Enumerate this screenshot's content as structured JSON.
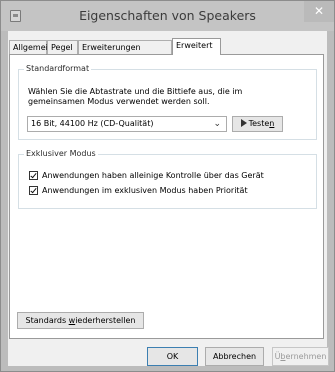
{
  "window": {
    "title": "Eigenschaften von Speakers",
    "close_glyph": "✕",
    "app_icon": "speaker-properties-icon"
  },
  "tabs": [
    {
      "label": "Allgemein"
    },
    {
      "label": "Pegel"
    },
    {
      "label": "Erweiterungen"
    },
    {
      "label": "Erweitert",
      "active": true
    }
  ],
  "standard_format": {
    "group_label": "Standardformat",
    "description": "Wählen Sie die Abtastrate und die Bittiefe aus, die im gemeinsamen Modus verwendet werden soll.",
    "selected_format": "16 Bit, 44100 Hz (CD-Qualität)",
    "test_label_pre": "Teste",
    "test_label_accel": "n"
  },
  "exclusive_mode": {
    "group_label": "Exklusiver Modus",
    "option1": {
      "label": "Anwendungen haben alleinige Kontrolle über das Gerät",
      "checked": true
    },
    "option2": {
      "label": "Anwendungen im exklusiven Modus haben Priorität",
      "checked": true
    }
  },
  "restore_defaults": {
    "pre": "Standards ",
    "accel": "w",
    "post": "iederherstellen"
  },
  "buttons": {
    "ok": "OK",
    "cancel": "Abbrechen",
    "apply_pre": "Ü",
    "apply_accel": "b",
    "apply_post": "ernehmen"
  }
}
